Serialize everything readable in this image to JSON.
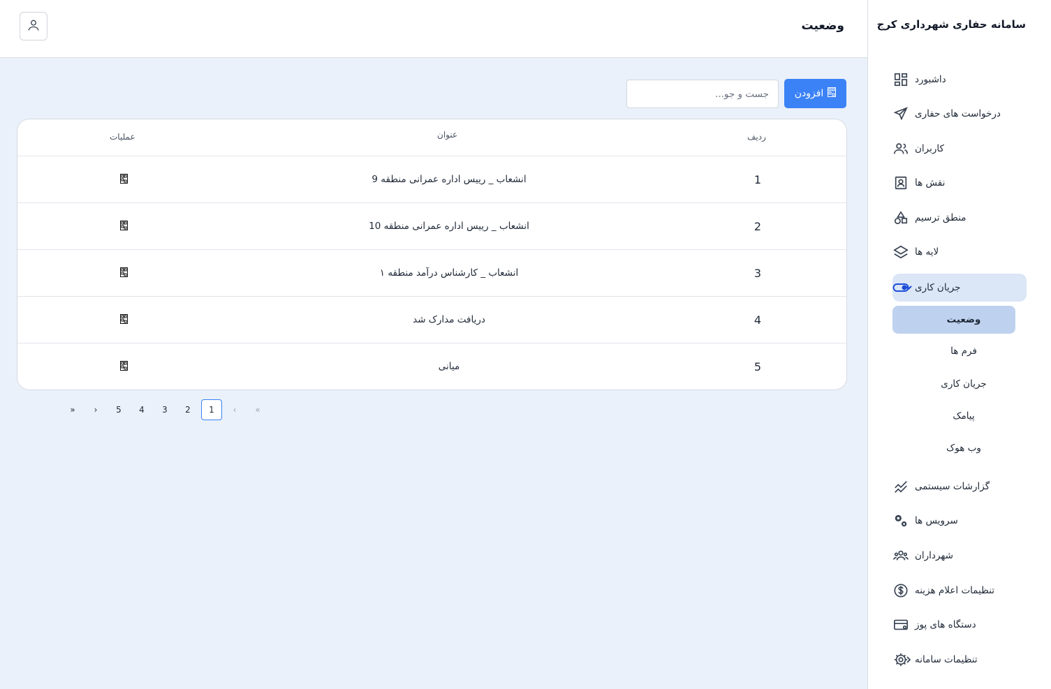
{
  "app": {
    "title": "سامانه حفاری شهرداری کرج"
  },
  "header": {
    "page_title": "وضعیت"
  },
  "sidebar": {
    "items": [
      {
        "label": "داشبورد",
        "icon": "dashboard-icon"
      },
      {
        "label": "درخواست های حفاری",
        "icon": "send-icon"
      },
      {
        "label": "کاربران",
        "icon": "users-icon"
      },
      {
        "label": "نقش ها",
        "icon": "roles-icon"
      },
      {
        "label": "منطق ترسیم",
        "icon": "shapes-icon"
      },
      {
        "label": "لایه ها",
        "icon": "layers-icon"
      },
      {
        "label": "جریان کاری",
        "icon": "toggle-icon",
        "expanded": true
      },
      {
        "label": "گزارشات سیستمی",
        "icon": "chart-icon"
      },
      {
        "label": "سرویس ها",
        "icon": "gears-icon"
      },
      {
        "label": "شهرداران",
        "icon": "group-icon"
      },
      {
        "label": "تنظیمات اعلام هزینه",
        "icon": "dollar-icon"
      },
      {
        "label": "دستگاه های پوز",
        "icon": "card-icon"
      },
      {
        "label": "تنظیمات سامانه",
        "icon": "settings-icon"
      }
    ],
    "subitems": [
      {
        "label": "وضعیت",
        "active": true
      },
      {
        "label": "فرم ها"
      },
      {
        "label": "جریان کاری"
      },
      {
        "label": "پیامک"
      },
      {
        "label": "وب هوک"
      }
    ]
  },
  "toolbar": {
    "add_label": "افزودن",
    "search_placeholder": "جست و جو..."
  },
  "table": {
    "columns": {
      "row": "ردیف",
      "title": "عنوان",
      "actions": "عملیات"
    },
    "rows": [
      {
        "num": "1",
        "title": "انشعاب _ رییس اداره عمرانی منطقه 9"
      },
      {
        "num": "2",
        "title": "انشعاب _ رییس اداره عمرانی منطقه 10"
      },
      {
        "num": "3",
        "title": "انشعاب _ کارشناس درآمد منطقه ۱"
      },
      {
        "num": "4",
        "title": "دریافت مدارک شد"
      },
      {
        "num": "5",
        "title": "میانی"
      }
    ]
  },
  "pagination": {
    "first": "«",
    "prev": "‹",
    "pages": [
      "1",
      "2",
      "3",
      "4",
      "5"
    ],
    "current": "1",
    "next": "›",
    "last": "»"
  },
  "colors": {
    "accent": "#3b82f6",
    "main_bg": "#eaf1fa",
    "active_nav": "#dbe6f6",
    "active_sub": "#bed2ef"
  }
}
